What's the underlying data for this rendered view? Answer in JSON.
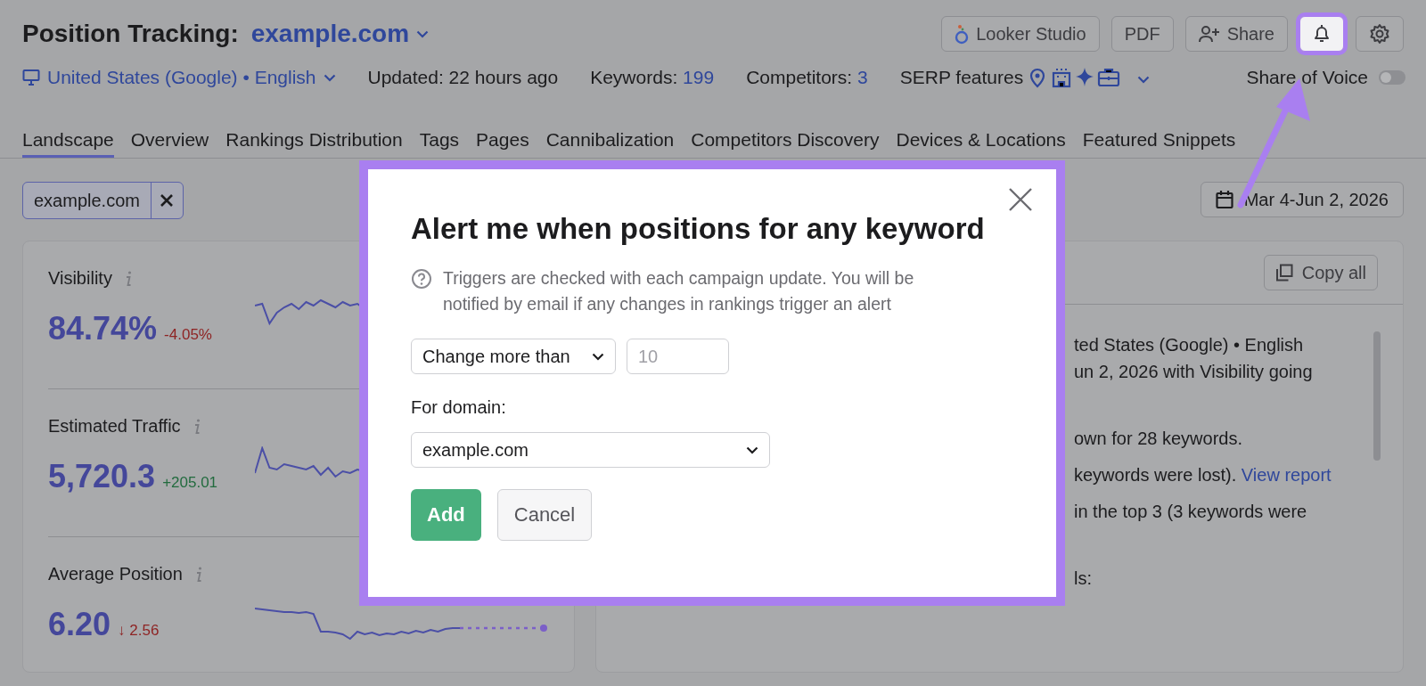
{
  "header": {
    "title": "Position Tracking:",
    "project": "example.com",
    "actions": [
      {
        "kind": "looker",
        "label": "Looker Studio",
        "highlighted": false
      },
      {
        "kind": "pdf",
        "label": "PDF",
        "highlighted": false
      },
      {
        "kind": "share",
        "label": "Share",
        "highlighted": false
      },
      {
        "kind": "bell",
        "highlighted": true
      },
      {
        "kind": "gear",
        "highlighted": false
      }
    ],
    "location": "United States (Google) • English",
    "updated": "Updated: 22 hours ago",
    "stats": [
      {
        "label": "Keywords:",
        "value": "199"
      },
      {
        "label": "Competitors:",
        "value": "3"
      }
    ],
    "serp_label": "SERP features",
    "share_of_voice": {
      "label": "Share of Voice",
      "on": false
    }
  },
  "tabs": [
    {
      "label": "Landscape",
      "selected": true
    },
    {
      "label": "Overview",
      "selected": false
    },
    {
      "label": "Rankings Distribution",
      "selected": false
    },
    {
      "label": "Tags",
      "selected": false
    },
    {
      "label": "Pages",
      "selected": false
    },
    {
      "label": "Cannibalization",
      "selected": false
    },
    {
      "label": "Competitors Discovery",
      "selected": false
    },
    {
      "label": "Devices & Locations",
      "selected": false
    },
    {
      "label": "Featured Snippets",
      "selected": false
    }
  ],
  "filter_chip": "example.com",
  "date_range": "Mar 4-Jun 2, 2026",
  "metrics": [
    {
      "label": "Visibility",
      "value": "84.74%",
      "change": "-4.05%",
      "color": "#8e2424"
    },
    {
      "label": "Estimated Traffic",
      "value": "5,720.3",
      "change": "+205.01",
      "color": "#226b3e"
    },
    {
      "label": "Average Position",
      "value": "6.20",
      "change": "↓ 2.56",
      "color": "#8e2424"
    }
  ],
  "summary": {
    "copy_button": "Copy all",
    "lines": [
      {
        "text": "ted States (Google) • English"
      },
      {
        "text": "un 2, 2026 with Visibility going"
      },
      {
        "text": "own for 28 keywords."
      },
      {
        "text": "keywords were lost).",
        "link": "View report"
      },
      {
        "text": "in the top 3 (3 keywords were"
      },
      {
        "text": "ls:"
      }
    ]
  },
  "dialog": {
    "title": "Alert me when positions for any keyword",
    "help": "Triggers are checked with each campaign update. You will be notified by email if any changes in rankings trigger an alert",
    "condition": "Change more than",
    "threshold_placeholder": "10",
    "domain_label": "For domain:",
    "domain": "example.com",
    "buttons": [
      {
        "kind": "primary",
        "label": "Add"
      },
      {
        "kind": "secondary",
        "label": "Cancel"
      }
    ]
  }
}
